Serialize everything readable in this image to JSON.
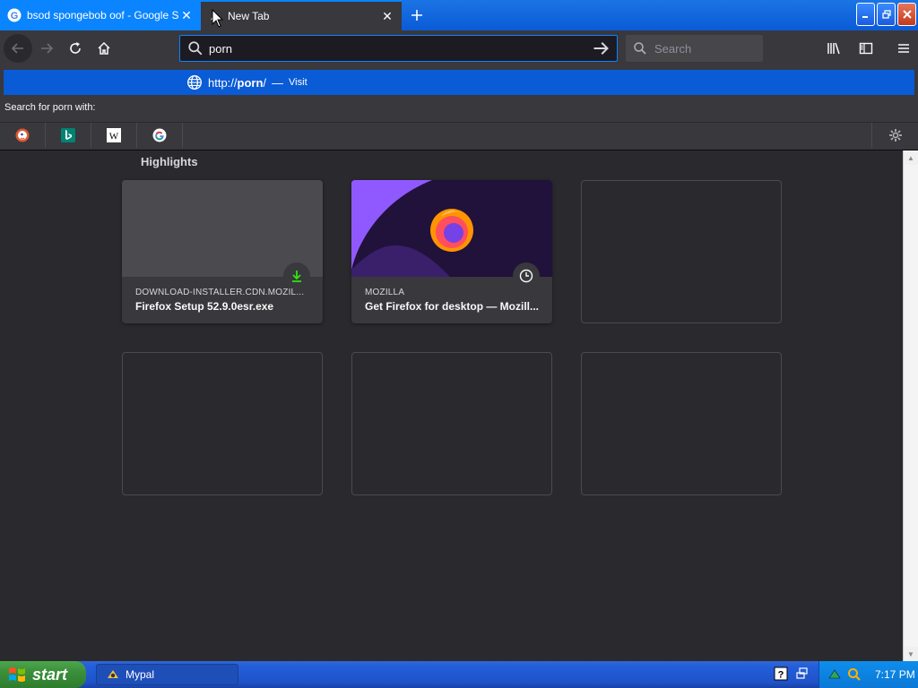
{
  "tabs": [
    {
      "title": "bsod spongebob oof - Google Search",
      "active": false
    },
    {
      "title": "New Tab",
      "active": true
    }
  ],
  "toolbar": {
    "url_value": "porn",
    "search_placeholder": "Search"
  },
  "dropdown": {
    "suggestion_prefix": "http://",
    "suggestion_bold": "porn",
    "suggestion_suffix": "/",
    "suggestion_sep": "—",
    "suggestion_action": "Visit",
    "search_with_label": "Search for porn with:",
    "engines": [
      "duckduckgo-icon",
      "bing-icon",
      "wikipedia-icon",
      "google-icon"
    ]
  },
  "content": {
    "section_title": "Highlights",
    "cards": [
      {
        "host": "DOWNLOAD-INSTALLER.CDN.MOZIL...",
        "title": "Firefox Setup 52.9.0esr.exe",
        "badge": "download-icon"
      },
      {
        "host": "MOZILLA",
        "title": "Get Firefox for desktop — Mozill...",
        "badge": "clock-icon"
      }
    ]
  },
  "taskbar": {
    "start_label": "start",
    "task_label": "Mypal",
    "clock": "7:17 PM"
  },
  "colors": {
    "accent": "#0a84ff",
    "toolbar": "#38383d",
    "page_bg": "#2a2a2e",
    "download_green": "#30e60b"
  }
}
